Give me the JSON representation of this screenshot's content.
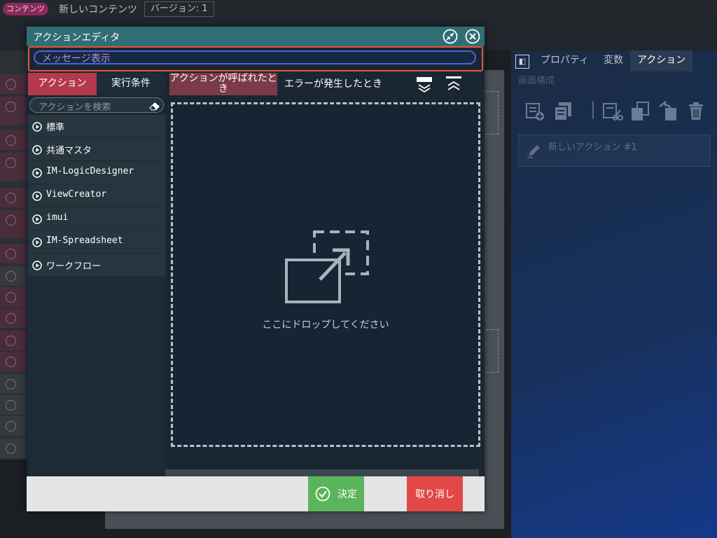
{
  "topbar": {
    "badge": "コンテンツ",
    "content_name": "新しいコンテンツ",
    "version": "バージョン: 1"
  },
  "right_panel": {
    "tabs": [
      "プロパティ",
      "変数",
      "アクション"
    ],
    "active_tab": "アクション",
    "section_label": "画面構成",
    "action_item": "新しいアクション #1"
  },
  "dialog": {
    "title": "アクションエディタ",
    "action_name": "メッセージ表示",
    "left_tabs": {
      "action": "アクション",
      "condition": "実行条件"
    },
    "search_placeholder": "アクションを検索",
    "categories": [
      "標準",
      "共通マスタ",
      "IM-LogicDesigner",
      "ViewCreator",
      "imui",
      "IM-Spreadsheet",
      "ワークフロー"
    ],
    "event_tabs": {
      "called": "アクションが呼ばれたとき",
      "error": "エラーが発生したとき"
    },
    "drop_text": "ここにドロップしてください",
    "ok_label": "決定",
    "cancel_label": "取り消し"
  },
  "colors": {
    "header_teal": "#2f6e74",
    "active_tab_red": "#b23a4c",
    "ok_green": "#5ab45c",
    "cancel_red": "#e24848",
    "highlight_orange": "#e8533a"
  }
}
